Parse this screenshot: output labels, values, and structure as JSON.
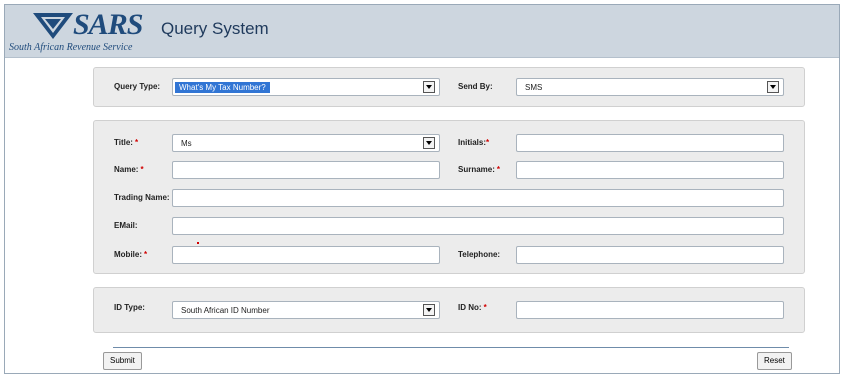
{
  "app": {
    "brand": "SARS",
    "brand_subtitle": "South African Revenue Service",
    "title": "Query System"
  },
  "query": {
    "type_label": "Query Type:",
    "type_value": "What's My Tax Number?",
    "send_label": "Send By:",
    "send_value": "SMS"
  },
  "details": {
    "title_label": "Title:",
    "title_value": "Ms",
    "initials_label": "Initials:",
    "initials_value": "",
    "name_label": "Name:",
    "name_value": "",
    "surname_label": "Surname:",
    "surname_value": "",
    "trading_label": "Trading Name:",
    "trading_value": "",
    "email_label": "EMail:",
    "email_value": "",
    "mobile_label": "Mobile:",
    "mobile_value": "",
    "telephone_label": "Telephone:",
    "telephone_value": ""
  },
  "identity": {
    "type_label": "ID Type:",
    "type_value": "South African ID Number",
    "no_label": "ID No:",
    "no_value": ""
  },
  "required_marker": "*",
  "buttons": {
    "submit": "Submit",
    "reset": "Reset"
  },
  "colors": {
    "brand": "#1f4b7c",
    "header_bg": "#cdd6df",
    "panel_bg": "#ececec",
    "required": "#d00000",
    "selection": "#3175d4"
  }
}
